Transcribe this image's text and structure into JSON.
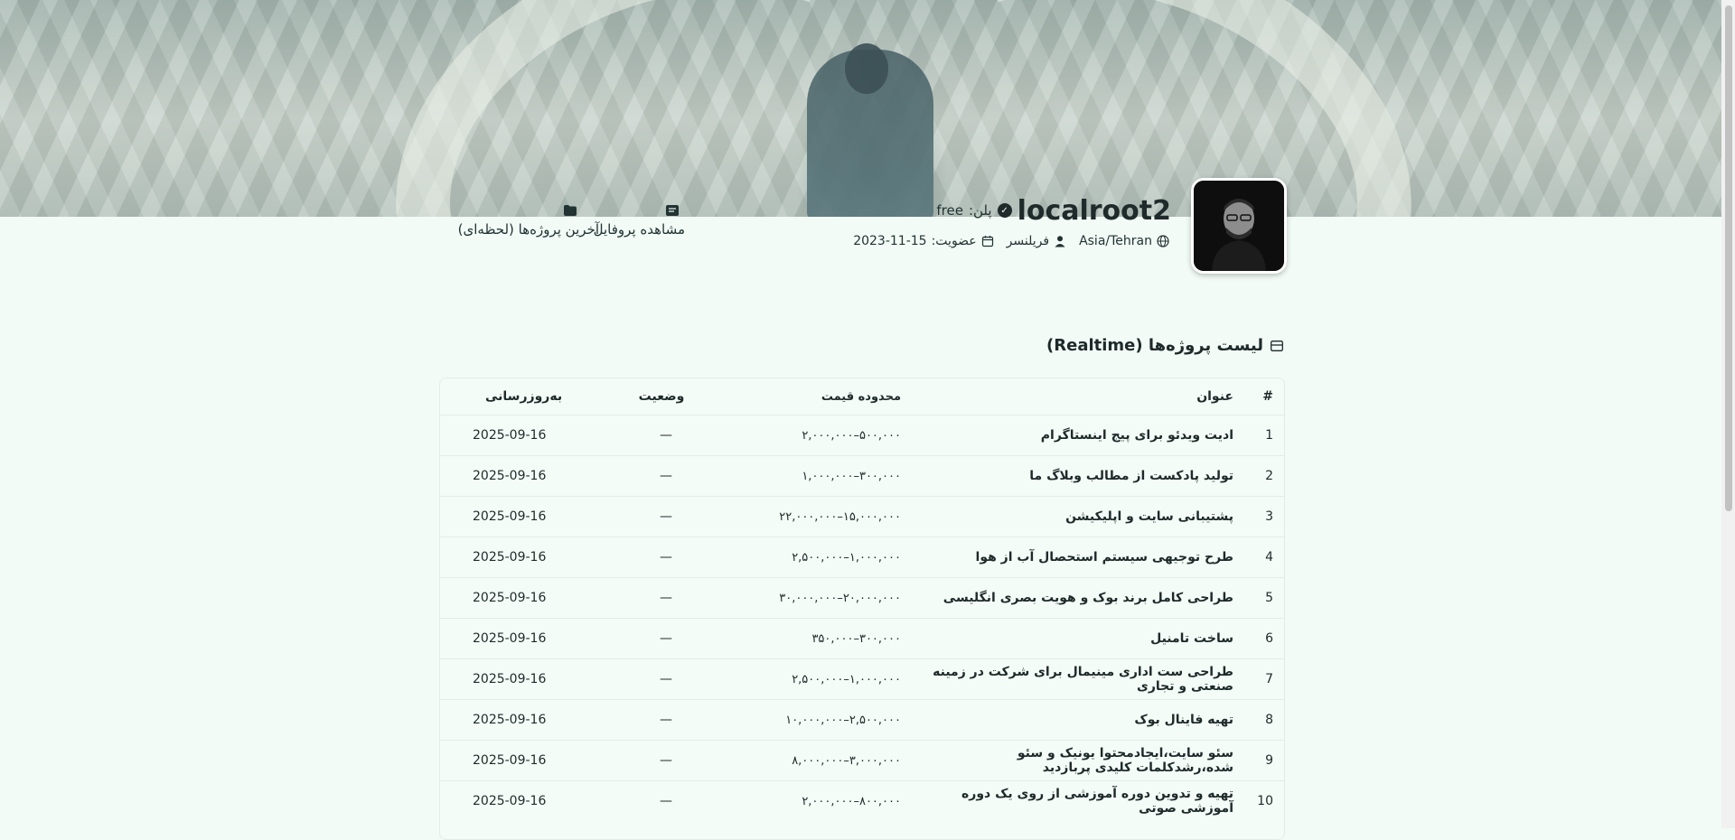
{
  "profile": {
    "username": "localroot2",
    "plan_label": "پلن:",
    "plan_value": "free",
    "timezone": "Asia/Tehran",
    "role": "فریلنسر",
    "member_label": "عضویت:",
    "member_since": "2023-11-15"
  },
  "nav": {
    "view_profile": "مشاهده پروفایل",
    "latest_projects": "آخرین پروژه‌ها (لحظه‌ای)"
  },
  "section": {
    "title": "لیست پروژه‌ها (Realtime)"
  },
  "table": {
    "headers": {
      "num": "#",
      "title": "عنوان",
      "price": "محدوده قیمت",
      "status": "وضعیت",
      "updated": "به‌روزرسانی"
    },
    "rows": [
      {
        "num": "1",
        "title": "ادیت ویدئو برای پیج اینستاگرام",
        "price": "۵۰۰,۰۰۰–۲,۰۰۰,۰۰۰",
        "status": "—",
        "updated": "2025-09-16"
      },
      {
        "num": "2",
        "title": "تولید پادکست از مطالب وبلاگ ما",
        "price": "۳۰۰,۰۰۰–۱,۰۰۰,۰۰۰",
        "status": "—",
        "updated": "2025-09-16"
      },
      {
        "num": "3",
        "title": "پشتیبانی سایت و اپلیکیشن",
        "price": "۱۵,۰۰۰,۰۰۰–۲۲,۰۰۰,۰۰۰",
        "status": "—",
        "updated": "2025-09-16"
      },
      {
        "num": "4",
        "title": "طرح توجیهی سیستم استحصال آب از هوا",
        "price": "۱,۰۰۰,۰۰۰–۲,۵۰۰,۰۰۰",
        "status": "—",
        "updated": "2025-09-16"
      },
      {
        "num": "5",
        "title": "طراحی کامل برند بوک و هویت بصری انگلیسی",
        "price": "۲۰,۰۰۰,۰۰۰–۳۰,۰۰۰,۰۰۰",
        "status": "—",
        "updated": "2025-09-16"
      },
      {
        "num": "6",
        "title": "ساخت تامنیل",
        "price": "۳۰۰,۰۰۰–۳۵۰,۰۰۰",
        "status": "—",
        "updated": "2025-09-16"
      },
      {
        "num": "7",
        "title": "طراحی ست اداری مینیمال برای شرکت در زمینه صنعتی و تجاری",
        "price": "۱,۰۰۰,۰۰۰–۲,۵۰۰,۰۰۰",
        "status": "—",
        "updated": "2025-09-16"
      },
      {
        "num": "8",
        "title": "تهیه فاینال بوک",
        "price": "۲,۵۰۰,۰۰۰–۱۰,۰۰۰,۰۰۰",
        "status": "—",
        "updated": "2025-09-16"
      },
      {
        "num": "9",
        "title": "سئو سایت،ایجادمحتوا یونیک و سئو شده،رشدکلمات کلیدی پربازدید",
        "price": "۳,۰۰۰,۰۰۰–۸,۰۰۰,۰۰۰",
        "status": "—",
        "updated": "2025-09-16"
      },
      {
        "num": "10",
        "title": "تهیه و تدوین دوره آموزشی از روی یک دوره آموزشی صوتی",
        "price": "۸۰۰,۰۰۰–۲,۰۰۰,۰۰۰",
        "status": "—",
        "updated": "2025-09-16"
      }
    ]
  }
}
